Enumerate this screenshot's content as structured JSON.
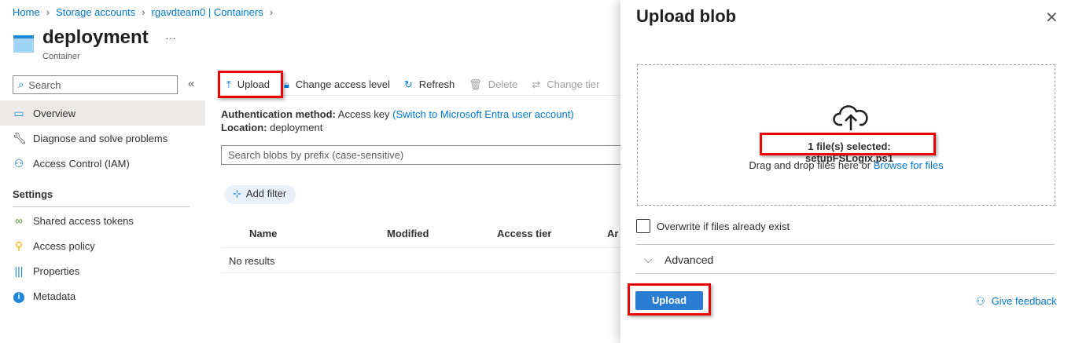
{
  "breadcrumb": [
    "Home",
    "Storage accounts",
    "rgavdteam0 | Containers"
  ],
  "header": {
    "title": "deployment",
    "subtitle": "Container",
    "more": "···"
  },
  "sidebar": {
    "search_placeholder": "Search",
    "collapse": "«",
    "items": [
      {
        "label": "Overview",
        "icon": "container-icon"
      },
      {
        "label": "Diagnose and solve problems",
        "icon": "wrench-icon"
      },
      {
        "label": "Access Control (IAM)",
        "icon": "people-icon"
      }
    ],
    "section": "Settings",
    "settings_items": [
      {
        "label": "Shared access tokens",
        "icon": "link-icon"
      },
      {
        "label": "Access policy",
        "icon": "key-icon"
      },
      {
        "label": "Properties",
        "icon": "properties-icon"
      },
      {
        "label": "Metadata",
        "icon": "info-icon"
      }
    ]
  },
  "toolbar": {
    "upload": "Upload",
    "change_access": "Change access level",
    "refresh": "Refresh",
    "delete": "Delete",
    "change_tier": "Change tier"
  },
  "info": {
    "auth_label": "Authentication method:",
    "auth_value": "Access key",
    "auth_link": "(Switch to Microsoft Entra user account)",
    "loc_label": "Location:",
    "loc_value": "deployment"
  },
  "blob_search_placeholder": "Search blobs by prefix (case-sensitive)",
  "add_filter": "Add filter",
  "table": {
    "columns": [
      "Name",
      "Modified",
      "Access tier",
      "Ar"
    ],
    "empty": "No results"
  },
  "panel": {
    "title": "Upload blob",
    "selected": "1 file(s) selected: setupFSLogix.ps1",
    "drag_text": "Drag and drop files here",
    "or": "or",
    "browse": "Browse for files",
    "overwrite": "Overwrite if files already exist",
    "advanced": "Advanced",
    "upload": "Upload",
    "feedback": "Give feedback"
  },
  "colors": {
    "accent": "#0078d4",
    "highlight": "#e00000",
    "button": "#2b7cd3"
  }
}
